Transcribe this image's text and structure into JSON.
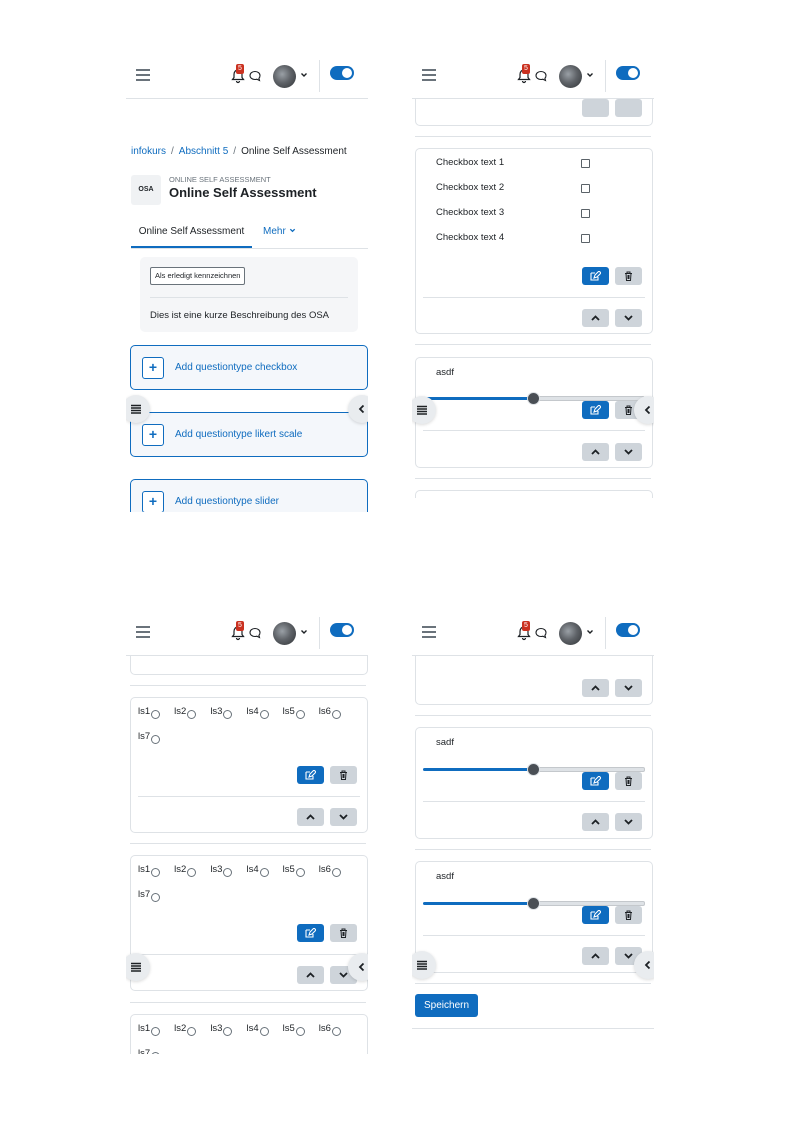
{
  "header": {
    "notifications_count": "5"
  },
  "breadcrumb": {
    "items": [
      "infokurs",
      "Abschnitt 5",
      "Online Self Assessment"
    ]
  },
  "activity": {
    "icon_text": "OSA",
    "pre_title": "ONLINE SELF ASSESSMENT",
    "title": "Online Self Assessment"
  },
  "tabs": {
    "active": "Online Self Assessment",
    "more": "Mehr"
  },
  "completion_button": "Als erledigt kennzeichnen",
  "description": "Dies ist eine kurze Beschreibung des OSA",
  "add_buttons": [
    "Add questiontype checkbox",
    "Add questiontype likert scale",
    "Add questiontype slider"
  ],
  "checkbox_question": {
    "items": [
      "Checkbox text 1",
      "Checkbox text 2",
      "Checkbox text 3",
      "Checkbox text 4"
    ]
  },
  "slider_questions": {
    "first": "asdf",
    "second": "sadf",
    "third": "asdf"
  },
  "slider_level_fraction": 0.5,
  "likert": {
    "row1": [
      "ls1",
      "ls2",
      "ls3",
      "ls4",
      "ls5",
      "ls6"
    ],
    "row2": [
      "ls7"
    ]
  },
  "save_button": "Speichern",
  "colors": {
    "primary": "#0f6cbf",
    "secondary_button": "#ced4da",
    "badge": "#ca3120"
  },
  "icons": [
    "hamburger-icon",
    "bell-icon",
    "chat-icon",
    "chevron-down-icon",
    "edit-icon",
    "trash-icon",
    "chevron-up-icon",
    "list-icon",
    "chevron-left-icon",
    "plus-icon"
  ]
}
